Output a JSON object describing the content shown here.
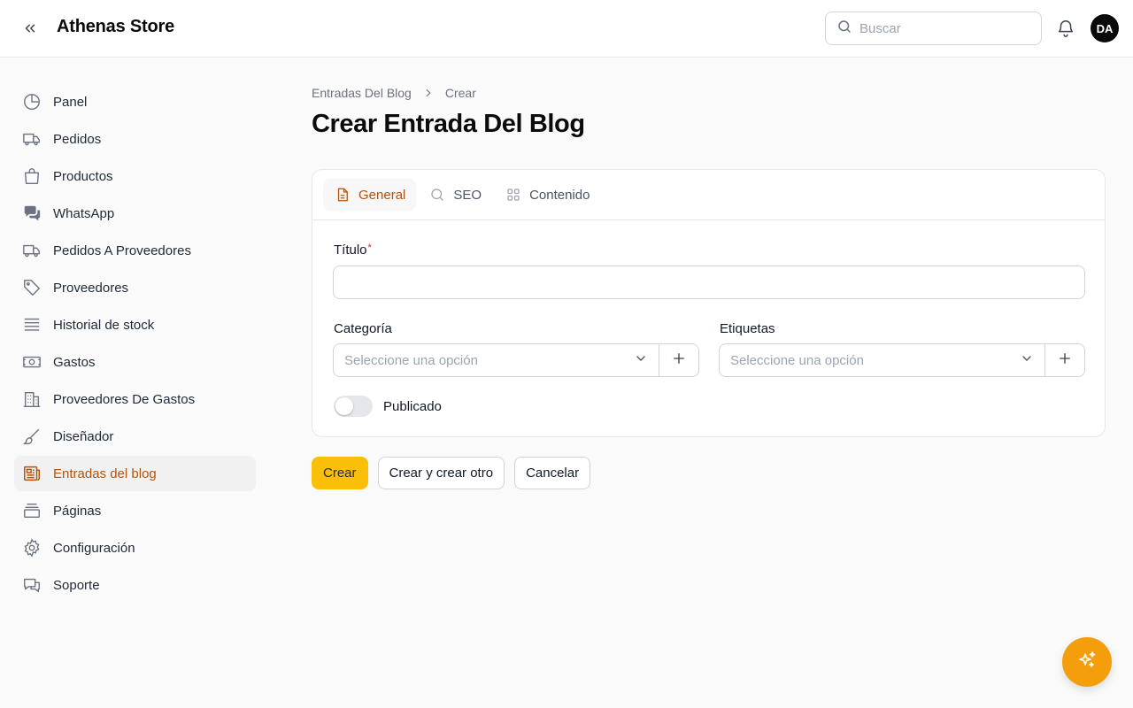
{
  "app": {
    "brand": "Athenas Store",
    "user_initials": "DA"
  },
  "search": {
    "placeholder": "Buscar"
  },
  "sidebar": {
    "items": [
      {
        "label": "Panel",
        "icon": "pie-chart-icon"
      },
      {
        "label": "Pedidos",
        "icon": "truck-icon"
      },
      {
        "label": "Productos",
        "icon": "shopping-bag-icon"
      },
      {
        "label": "WhatsApp",
        "icon": "chat-bubbles-icon"
      },
      {
        "label": "Pedidos A Proveedores",
        "icon": "truck-icon"
      },
      {
        "label": "Proveedores",
        "icon": "tag-icon"
      },
      {
        "label": "Historial de stock",
        "icon": "stack-icon"
      },
      {
        "label": "Gastos",
        "icon": "banknote-icon"
      },
      {
        "label": "Proveedores De Gastos",
        "icon": "building-icon"
      },
      {
        "label": "Diseñador",
        "icon": "paintbrush-icon"
      },
      {
        "label": "Entradas del blog",
        "icon": "newspaper-icon",
        "active": true
      },
      {
        "label": "Páginas",
        "icon": "archive-box-icon"
      },
      {
        "label": "Configuración",
        "icon": "gear-icon"
      },
      {
        "label": "Soporte",
        "icon": "support-chat-icon"
      }
    ]
  },
  "breadcrumb": {
    "parent": "Entradas Del Blog",
    "current": "Crear"
  },
  "page": {
    "title": "Crear Entrada Del Blog"
  },
  "tabs": [
    {
      "label": "General",
      "icon": "document-icon",
      "active": true
    },
    {
      "label": "SEO",
      "icon": "search-icon"
    },
    {
      "label": "Contenido",
      "icon": "grid-icon"
    }
  ],
  "form": {
    "title_label": "Título",
    "title_value": "",
    "category": {
      "label": "Categoría",
      "placeholder": "Seleccione una opción"
    },
    "tags": {
      "label": "Etiquetas",
      "placeholder": "Seleccione una opción"
    },
    "published": {
      "label": "Publicado",
      "value": false
    }
  },
  "actions": {
    "create": "Crear",
    "create_another": "Crear y crear otro",
    "cancel": "Cancelar"
  },
  "colors": {
    "accent": "#b45309",
    "primary_button": "#fbbf0a",
    "fab": "#f59e0b"
  }
}
